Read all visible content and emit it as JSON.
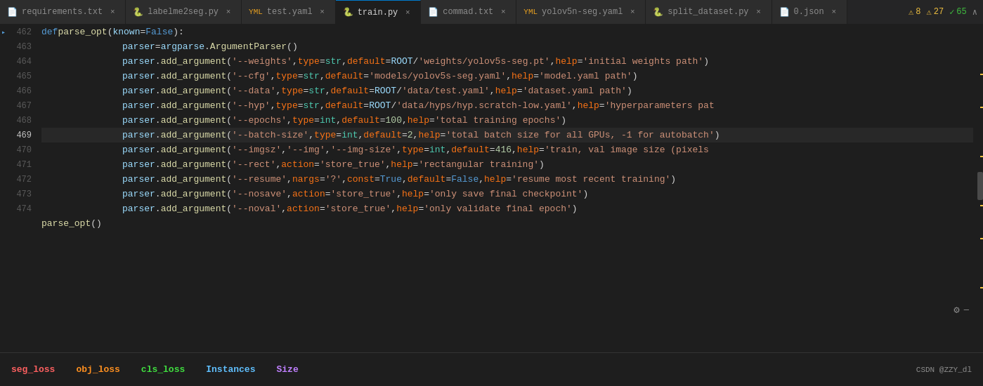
{
  "tabs": [
    {
      "id": "requirements",
      "label": "requirements.txt",
      "icon": "📄",
      "iconColor": "#d4d4d4",
      "active": false
    },
    {
      "id": "labelme2seg",
      "label": "labelme2seg.py",
      "icon": "🐍",
      "iconColor": "#3572a5",
      "active": false
    },
    {
      "id": "test",
      "label": "test.yaml",
      "icon": "📋",
      "iconColor": "#e8a020",
      "active": false
    },
    {
      "id": "train",
      "label": "train.py",
      "icon": "🐍",
      "iconColor": "#f7dc6f",
      "active": true
    },
    {
      "id": "commad",
      "label": "commad.txt",
      "icon": "📄",
      "iconColor": "#d4d4d4",
      "active": false
    },
    {
      "id": "yolov5n-seg",
      "label": "yolov5n-seg.yaml",
      "icon": "📋",
      "iconColor": "#e8a020",
      "active": false
    },
    {
      "id": "split_dataset",
      "label": "split_dataset.py",
      "icon": "🐍",
      "iconColor": "#3572a5",
      "active": false
    },
    {
      "id": "json",
      "label": "0.json",
      "icon": "📄",
      "iconColor": "#d4d4d4",
      "active": false
    }
  ],
  "indicators": {
    "warnings": "8",
    "errors": "27",
    "ok": "65",
    "warning_icon": "⚠",
    "ok_icon": "✓",
    "chevron_up": "∧"
  },
  "lines": [
    {
      "num": "462",
      "current": false,
      "has_indicator": true
    },
    {
      "num": "463",
      "current": false
    },
    {
      "num": "464",
      "current": false
    },
    {
      "num": "465",
      "current": false
    },
    {
      "num": "466",
      "current": false
    },
    {
      "num": "467",
      "current": false
    },
    {
      "num": "468",
      "current": false
    },
    {
      "num": "469",
      "current": true
    },
    {
      "num": "470",
      "current": false
    },
    {
      "num": "471",
      "current": false
    },
    {
      "num": "472",
      "current": false
    },
    {
      "num": "473",
      "current": false
    },
    {
      "num": "474",
      "current": false
    },
    {
      "num": "",
      "current": false
    },
    {
      "num": "",
      "current": false
    }
  ],
  "status_bar": {
    "seg_loss_label": "seg_loss",
    "obj_loss_label": "obj_loss",
    "cls_loss_label": "cls_loss",
    "instances_label": "Instances",
    "size_label": "Size",
    "right_text": "CSDN @ZZY_dl"
  },
  "settings": {
    "gear_icon": "⚙",
    "separator": "—"
  }
}
